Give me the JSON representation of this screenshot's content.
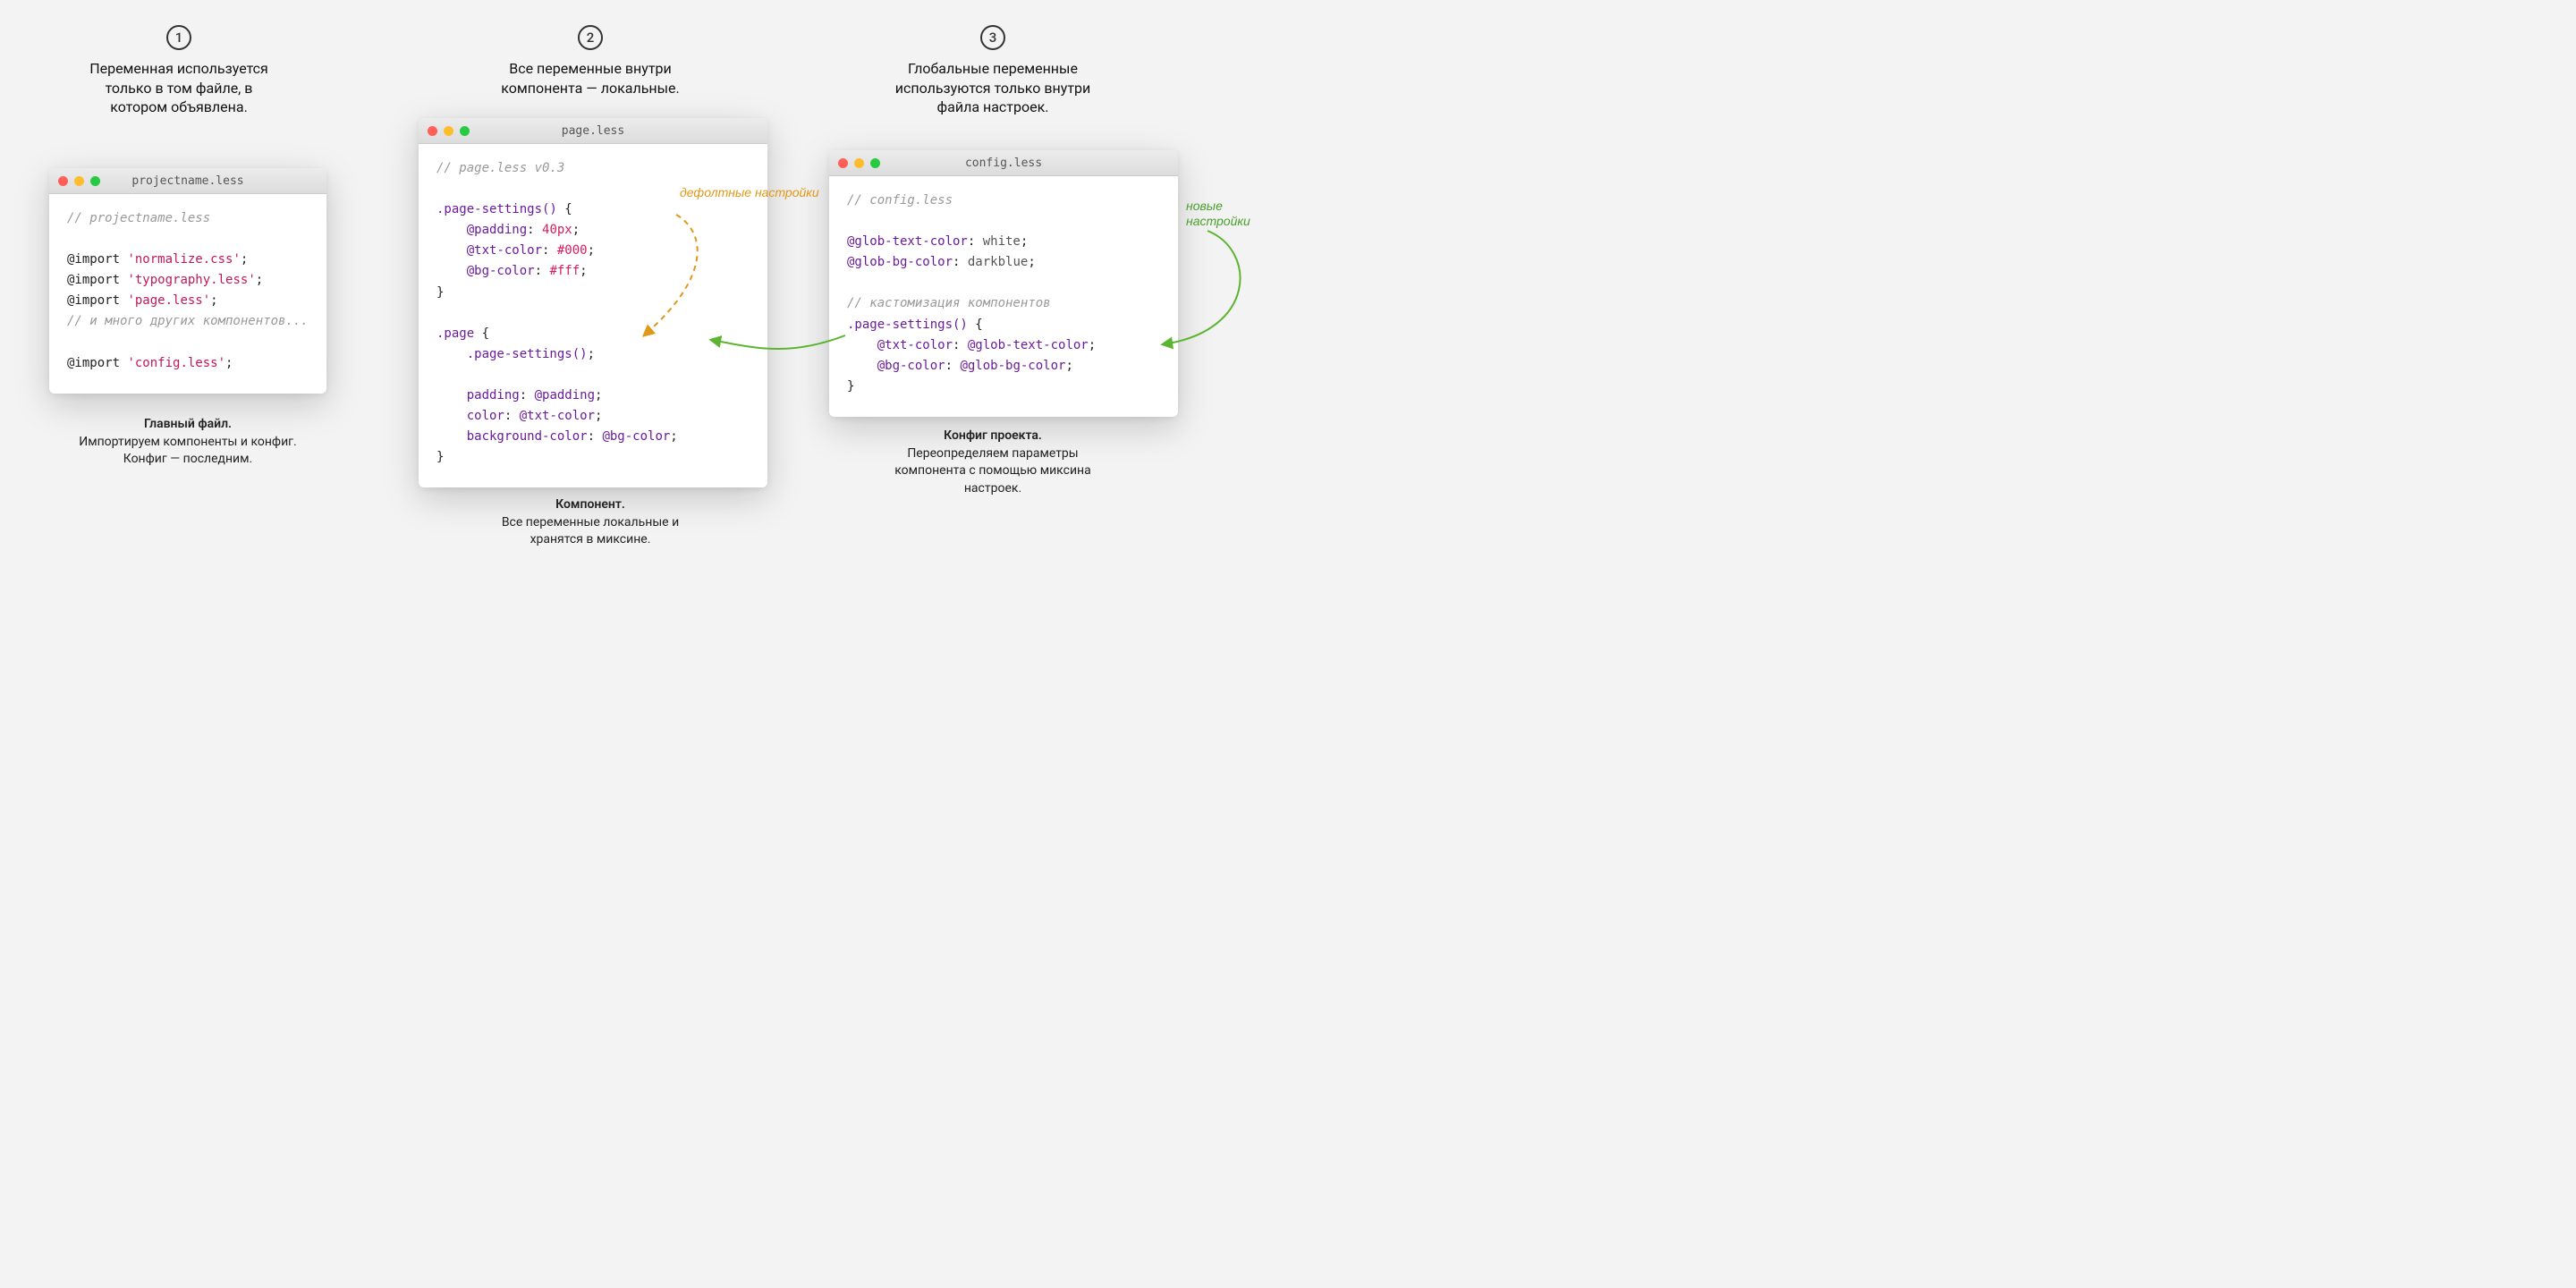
{
  "steps": [
    {
      "num": "1",
      "text": "Переменная используется\nтолько в том файле, в\nкотором объявлена."
    },
    {
      "num": "2",
      "text": "Все переменные внутри\nкомпонента — локальные."
    },
    {
      "num": "3",
      "text": "Глобальные переменные\nиспользуются только внутри\nфайла настроек."
    }
  ],
  "windows": {
    "left": {
      "title": "projectname.less",
      "comment1": "// projectname.less",
      "import_kw": "@import",
      "imp1": "'normalize.css'",
      "imp2": "'typography.less'",
      "imp3": "'page.less'",
      "comment2": "// и много других компонентов...",
      "imp4": "'config.less'"
    },
    "mid": {
      "title": "page.less",
      "comment1": "// page.less v0.3",
      "sel_settings": ".page-settings()",
      "var_padding": "@padding",
      "val_padding": "40px",
      "var_txt": "@txt-color",
      "val_txt": "#000",
      "var_bg": "@bg-color",
      "val_bg": "#fff",
      "sel_page": ".page",
      "call_settings": ".page-settings()",
      "prop_padding": "padding",
      "ref_padding": "@padding",
      "prop_color": "color",
      "ref_txt": "@txt-color",
      "prop_bg": "background-color",
      "ref_bg": "@bg-color"
    },
    "right": {
      "title": "config.less",
      "comment1": "// config.less",
      "var_glob_txt": "@glob-text-color",
      "val_glob_txt": "white",
      "var_glob_bg": "@glob-bg-color",
      "val_glob_bg": "darkblue",
      "comment2": "// кастомизация компонентов",
      "sel_settings": ".page-settings()",
      "var_txt": "@txt-color",
      "ref_glob_txt": "@glob-text-color",
      "var_bg": "@bg-color",
      "ref_glob_bg": "@glob-bg-color"
    }
  },
  "captions": {
    "left": {
      "title": "Главный файл.",
      "body": "Импортируем компоненты и конфиг.\nКонфиг — последним."
    },
    "mid": {
      "title": "Компонент.",
      "body": "Все переменные локальные и\nхранятся в миксине."
    },
    "right": {
      "title": "Конфиг проекта.",
      "body": "Переопределяем параметры\nкомпонента с помощью миксина\nнастроек."
    }
  },
  "annotations": {
    "default": "дефолтные\nнастройки",
    "new": "новые\nнастройки"
  }
}
